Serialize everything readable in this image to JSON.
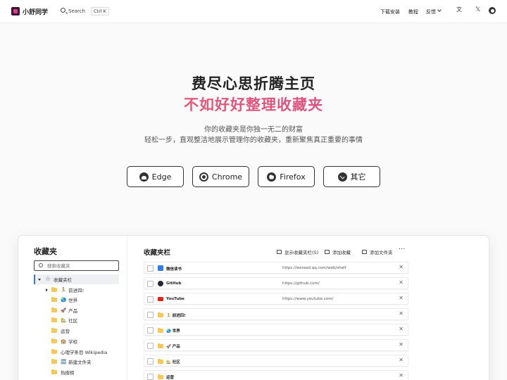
{
  "header": {
    "brand": "小舒同学",
    "search_label": "Search",
    "search_shortcut": "Ctrl K",
    "nav": [
      "下载安装",
      "教程",
      "反馈"
    ],
    "icons": [
      "translate-icon",
      "x-twitter-icon",
      "github-icon"
    ]
  },
  "hero": {
    "title_line1": "费尽心思折腾主页",
    "title_line2": "不如好好整理收藏夹",
    "subtitle_line1": "你的收藏夹是你独一无二的财富",
    "subtitle_line2": "轻松一步，直观整洁地展示管理你的收藏夹，重新聚焦真正重要的事情",
    "gradient_colors": [
      "#f07a6a",
      "#e0557a",
      "#d1508c"
    ]
  },
  "downloads": [
    {
      "label": "Edge",
      "icon": "edge-icon"
    },
    {
      "label": "Chrome",
      "icon": "chrome-icon"
    },
    {
      "label": "Firefox",
      "icon": "firefox-icon"
    },
    {
      "label": "其它",
      "icon": "download-icon"
    }
  ],
  "sidebar": {
    "title": "收藏夹",
    "search_placeholder": "搜索收藏夹",
    "root": "收藏夹栏",
    "items": [
      {
        "label": "前进四!",
        "emoji": "🏃"
      },
      {
        "label": "世界",
        "emoji": "🌏"
      },
      {
        "label": "产品",
        "emoji": "🚀"
      },
      {
        "label": "社区",
        "emoji": "🏡"
      },
      {
        "label": "运营",
        "emoji": ""
      },
      {
        "label": "学校",
        "emoji": "🏫"
      },
      {
        "label": "心理学条目 Wikipedia",
        "emoji": ""
      },
      {
        "label": "新建文件夹",
        "emoji": "🆕"
      },
      {
        "label": "热搜榜",
        "emoji": ""
      }
    ]
  },
  "main": {
    "title": "收藏夹栏",
    "toolbar": [
      "显示收藏夹栏(S)",
      "添加收藏",
      "添加文件夹"
    ],
    "more": "···",
    "rows": [
      {
        "type": "link",
        "name": "微信读书",
        "url": "https://weread.qq.com/web/shelf",
        "icon_color": "#2f7de1"
      },
      {
        "type": "link",
        "name": "GitHub",
        "url": "https://github.com/",
        "icon_color": "#24292f"
      },
      {
        "type": "link",
        "name": "YouTube",
        "url": "https://www.youtube.com/",
        "icon_color": "#e62117"
      },
      {
        "type": "folder",
        "name": "前进四!",
        "emoji": "🏃"
      },
      {
        "type": "folder",
        "name": "世界",
        "emoji": "🌏"
      },
      {
        "type": "folder",
        "name": "产品",
        "emoji": "🚀"
      },
      {
        "type": "folder",
        "name": "社区",
        "emoji": "🏡"
      },
      {
        "type": "folder",
        "name": "运营",
        "emoji": ""
      }
    ]
  }
}
